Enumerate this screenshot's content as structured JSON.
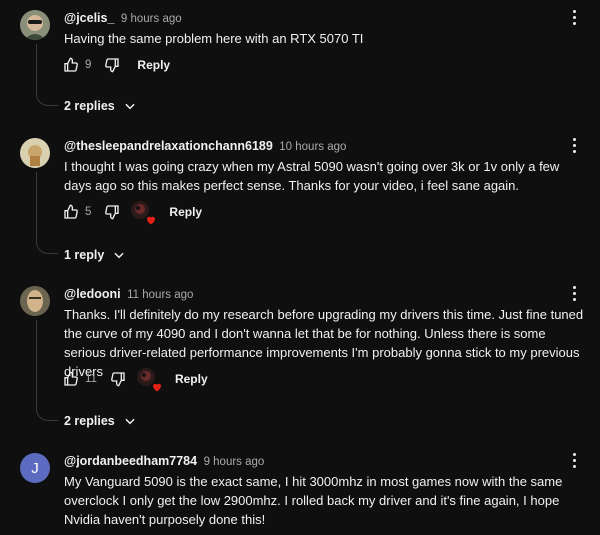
{
  "comments": [
    {
      "handle": "@jcelis_",
      "time": "9 hours ago",
      "text": "Having the same problem here with an RTX 5070 TI",
      "likes": "9",
      "reply_label": "Reply",
      "replies_label": "2 replies",
      "creator_heart": false
    },
    {
      "handle": "@thesleepandrelaxationchann6189",
      "time": "10 hours ago",
      "text": "I thought I was going crazy when my Astral 5090 wasn't going over 3k or 1v only a few days ago so this makes perfect sense.  Thanks for your video, i feel sane again.",
      "likes": "5",
      "reply_label": "Reply",
      "replies_label": "1 reply",
      "creator_heart": true
    },
    {
      "handle": "@ledooni",
      "time": "11 hours ago",
      "text": "Thanks. I'll definitely do my research before upgrading my drivers this time. Just fine tuned the curve of my 4090 and I don't wanna let that be for nothing. Unless there is some serious driver-related performance improvements I'm probably gonna stick to my previous drivers",
      "likes": "11",
      "reply_label": "Reply",
      "replies_label": "2 replies",
      "creator_heart": true
    },
    {
      "handle": "@jordanbeedham7784",
      "time": "9 hours ago",
      "text": "My Vanguard 5090 is the exact same, I hit 3000mhz in most games now with the same overclock I only get the low 2900mhz. I rolled back my driver and it's fine again, I hope Nvidia haven't purposely done this!",
      "avatar_letter": "J"
    }
  ],
  "colors": {
    "background": "#0f0f0f",
    "text": "#f1f1f1",
    "muted": "#aaaaaa",
    "heart": "#e62117",
    "avatar_j": "#5c6bc0"
  }
}
